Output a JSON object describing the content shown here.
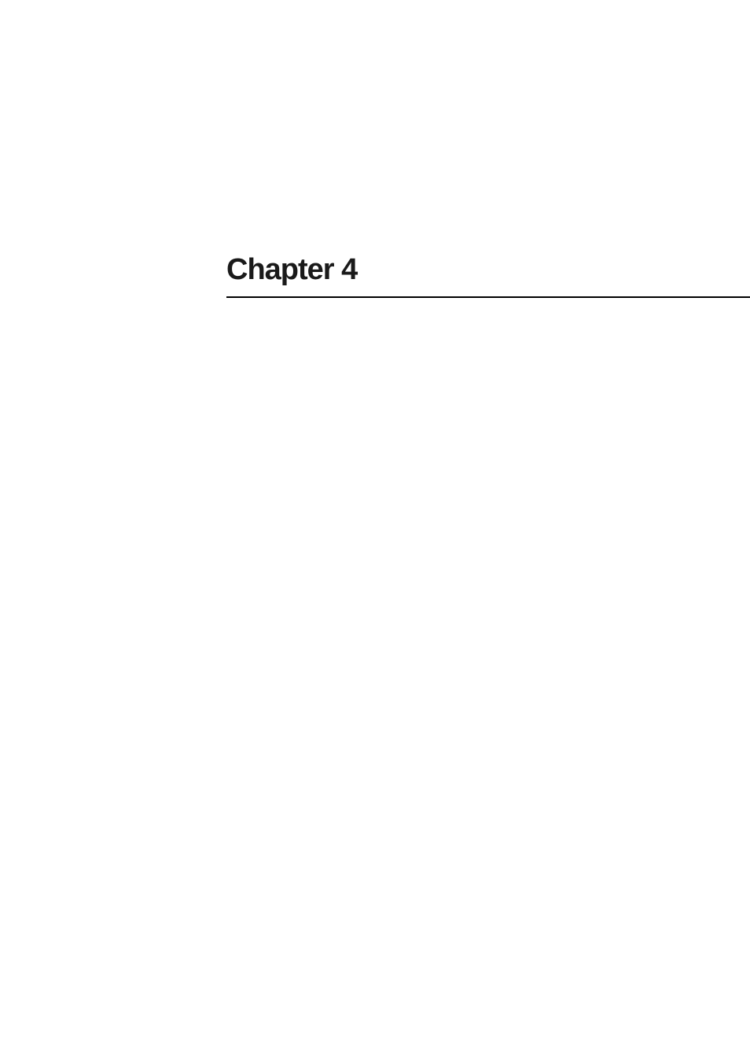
{
  "chapter": {
    "title": "Chapter 4"
  }
}
